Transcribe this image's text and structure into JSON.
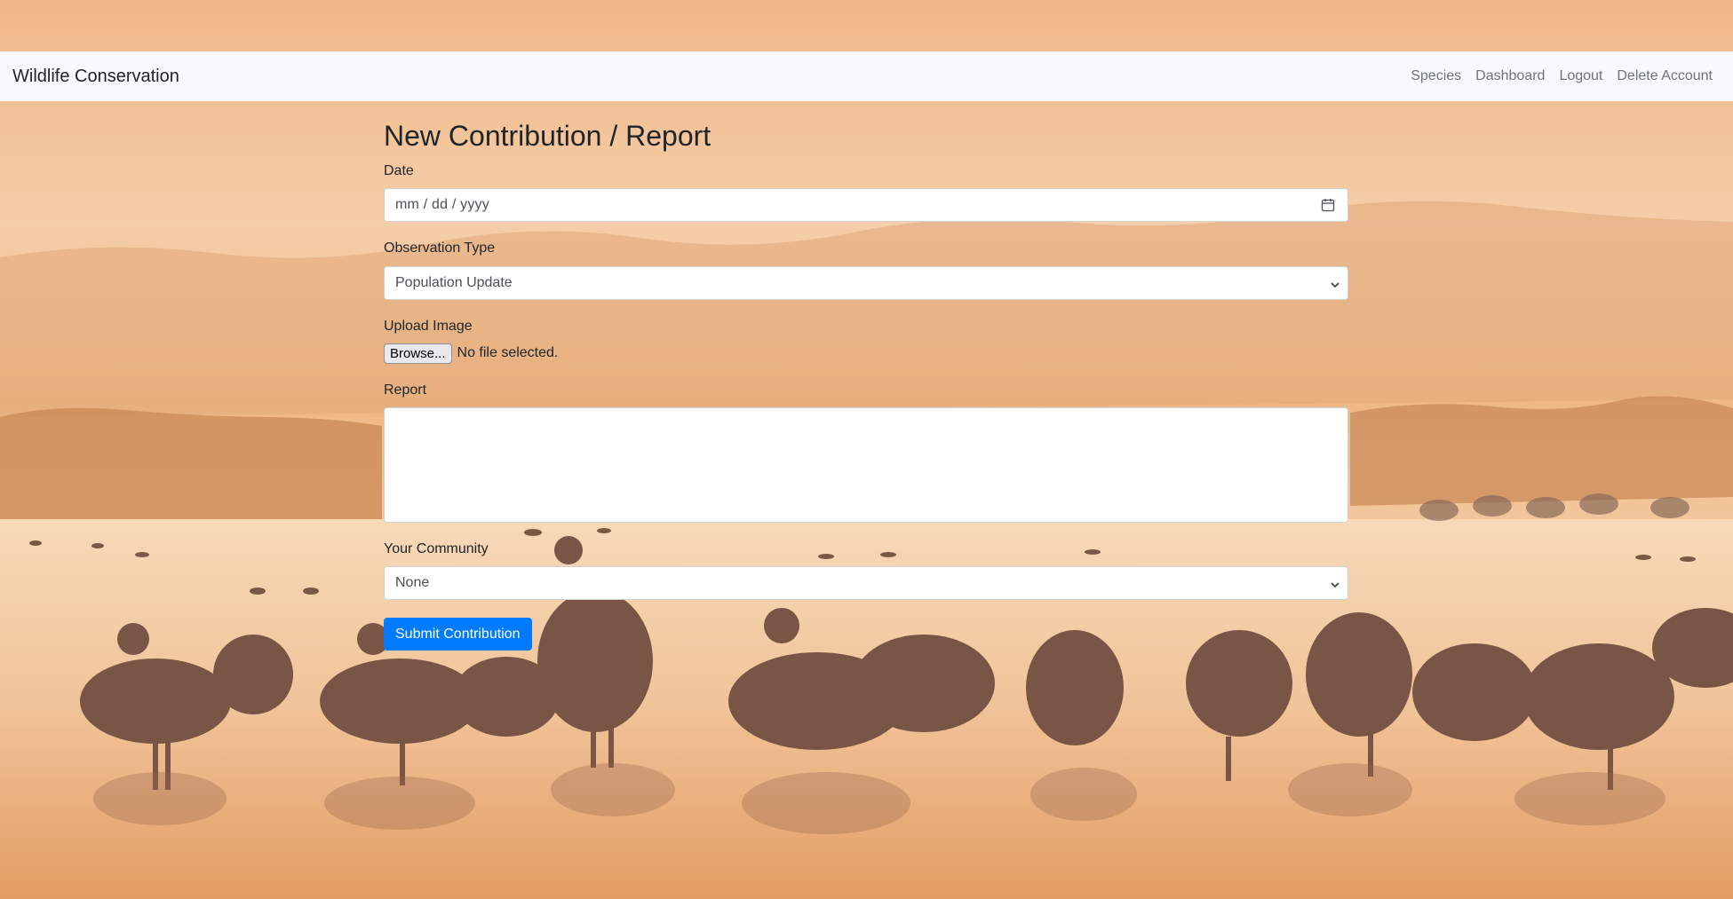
{
  "navbar": {
    "brand": "Wildlife Conservation",
    "links": [
      "Species",
      "Dashboard",
      "Logout",
      "Delete Account"
    ]
  },
  "form": {
    "title": "New Contribution / Report",
    "date": {
      "label": "Date",
      "placeholder": "mm / dd / yyyy",
      "icon": "calendar-icon"
    },
    "observation_type": {
      "label": "Observation Type",
      "selected": "Population Update",
      "icon": "chevron-down-icon"
    },
    "upload_image": {
      "label": "Upload Image",
      "button": "Browse...",
      "status": "No file selected."
    },
    "report": {
      "label": "Report",
      "value": ""
    },
    "community": {
      "label": "Your Community",
      "selected": "None",
      "icon": "chevron-down-icon"
    },
    "submit_label": "Submit Contribution"
  },
  "colors": {
    "primary": "#007bff",
    "navbar_bg": "#f8f9fa",
    "sky": "#f3c9a0"
  }
}
